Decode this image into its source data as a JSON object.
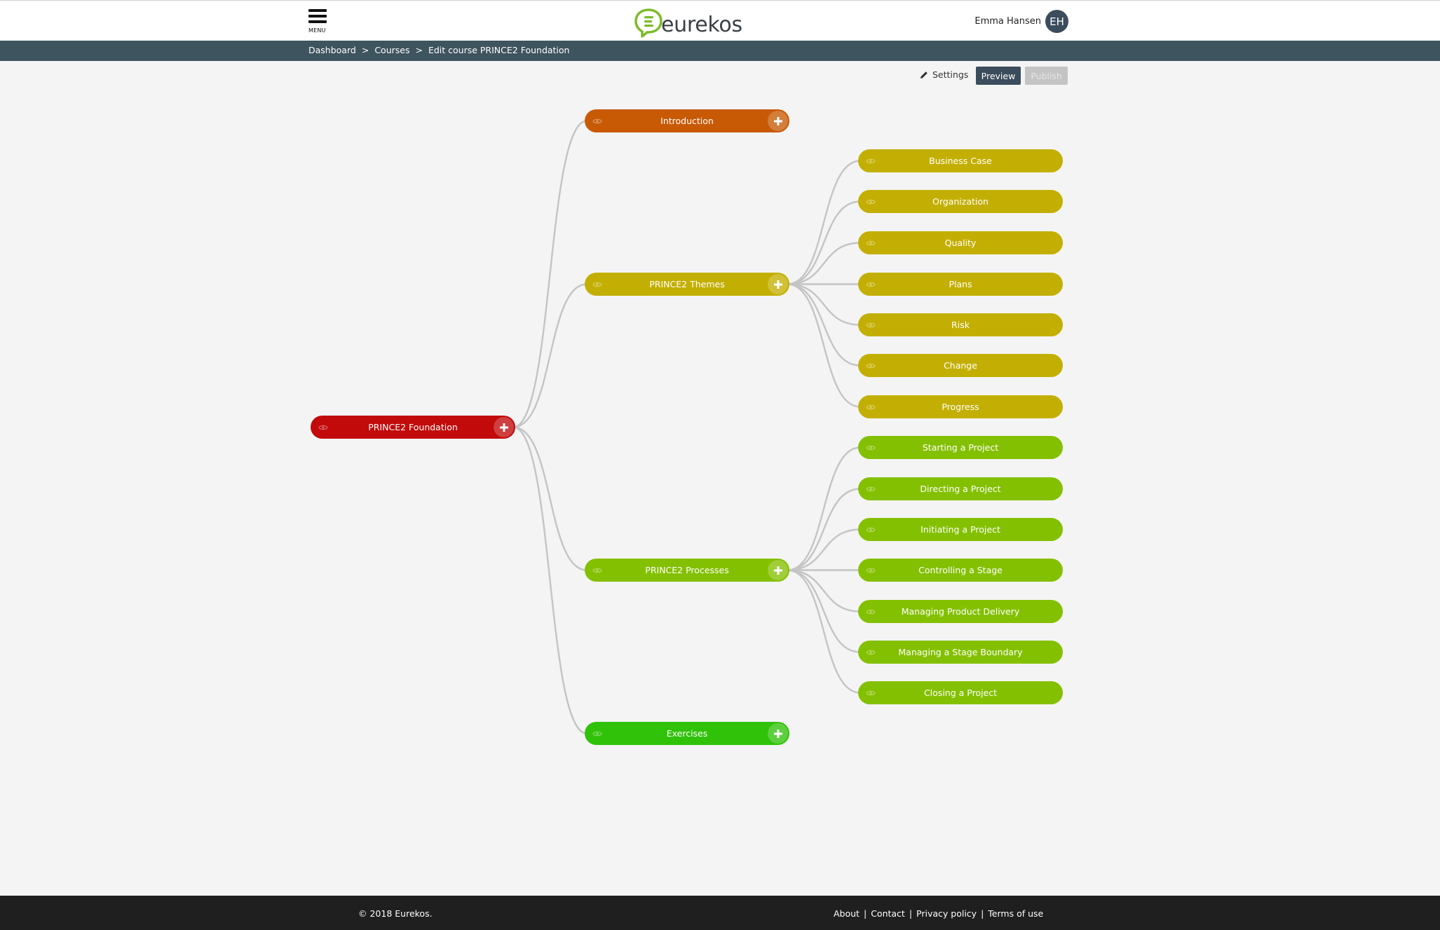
{
  "header": {
    "menu_label": "MENU",
    "logo_text": "eurekos",
    "user_name": "Emma Hansen",
    "user_initials": "EH"
  },
  "breadcrumb": {
    "items": [
      "Dashboard",
      "Courses",
      "Edit course PRINCE2 Foundation"
    ],
    "separator": ">"
  },
  "toolbar": {
    "settings_label": "Settings",
    "preview_label": "Preview",
    "publish_label": "Publish"
  },
  "mindmap": {
    "root": {
      "label": "PRINCE2 Foundation",
      "color": "#c20a0a"
    },
    "level1": [
      {
        "label": "Introduction",
        "color": "#c85a06"
      },
      {
        "label": "PRINCE2 Themes",
        "color": "#c3af03"
      },
      {
        "label": "PRINCE2 Processes",
        "color": "#84c002"
      },
      {
        "label": "Exercises",
        "color": "#30c209"
      }
    ],
    "themes_children": [
      "Business Case",
      "Organization",
      "Quality",
      "Plans",
      "Risk",
      "Change",
      "Progress"
    ],
    "processes_children": [
      "Starting a Project",
      "Directing a Project",
      "Initiating a Project",
      "Controlling a Stage",
      "Managing Product Delivery",
      "Managing a Stage Boundary",
      "Closing a Project"
    ]
  },
  "footer": {
    "copyright": "© 2018 Eurekos.",
    "links": [
      "About",
      "Contact",
      "Privacy policy",
      "Terms of use"
    ]
  },
  "colors": {
    "header_bg": "#ffffff",
    "breadcrumb_bg": "#3e545f",
    "accent_dark": "#3b4c5c",
    "page_bg": "#f4f4f4",
    "footer_bg": "#1f1f1f",
    "connector": "#c4c4c4"
  }
}
